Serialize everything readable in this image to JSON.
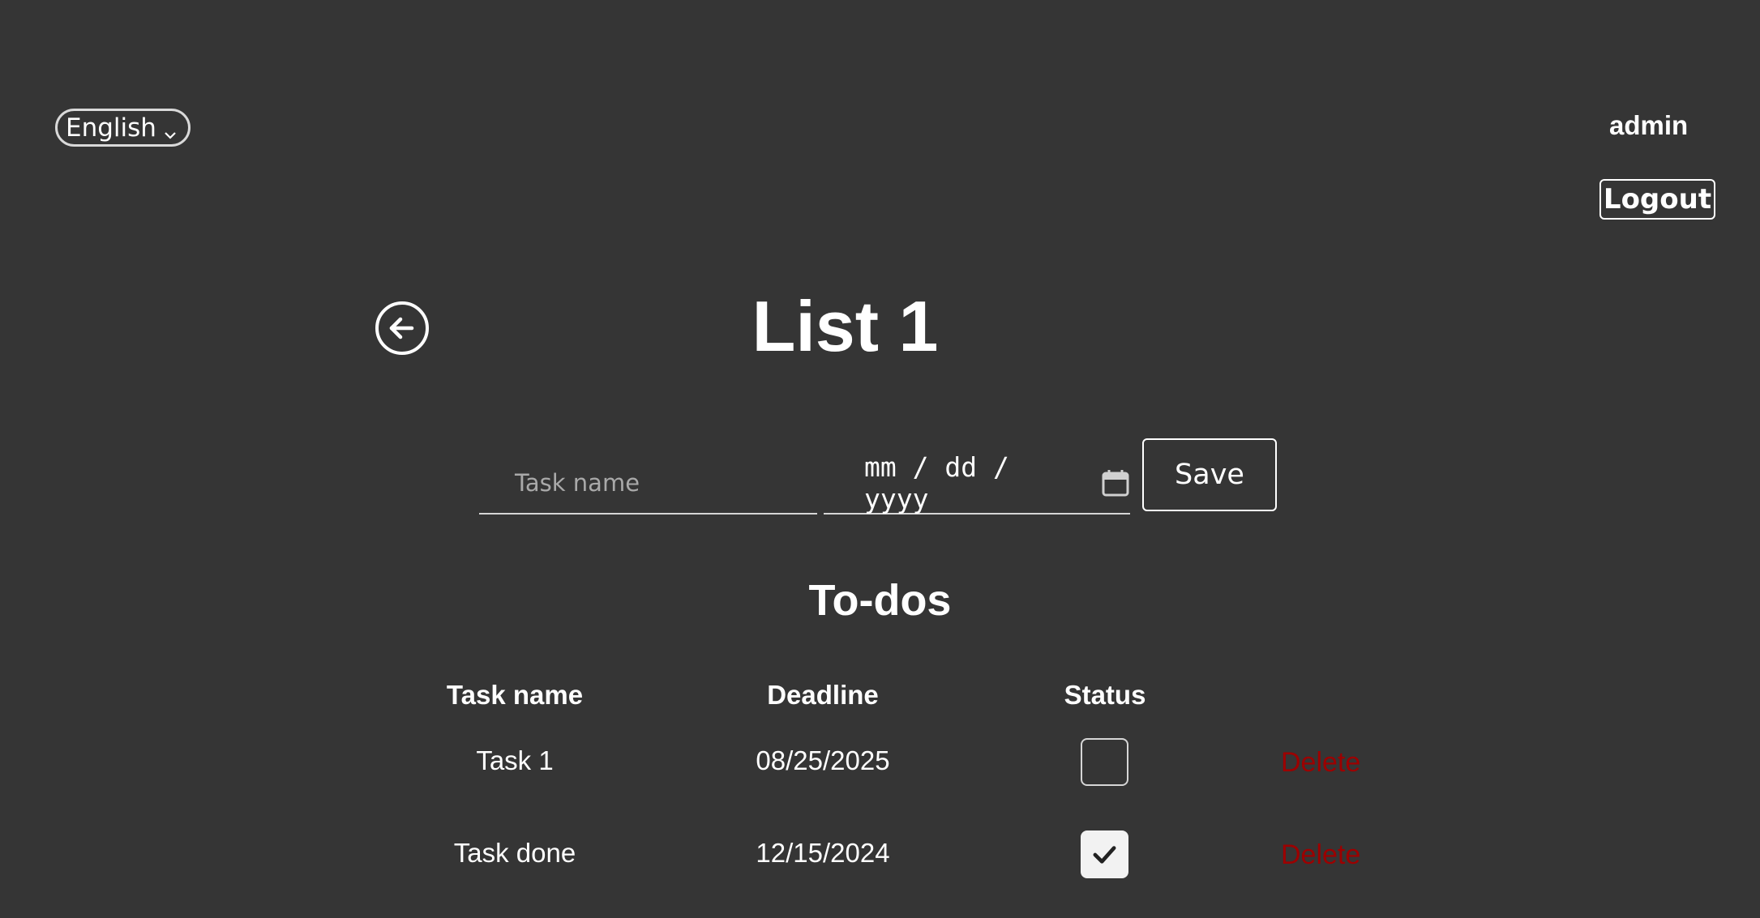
{
  "header": {
    "language": {
      "selected": "English"
    },
    "user": {
      "name": "admin",
      "logout_label": "Logout"
    }
  },
  "main": {
    "title": "List 1",
    "form": {
      "task_placeholder": "Task name",
      "date_placeholder": "mm / dd / yyyy",
      "save_label": "Save"
    },
    "todos": {
      "title": "To-dos",
      "columns": [
        "Task name",
        "Deadline",
        "Status"
      ],
      "rows": [
        {
          "name": "Task 1",
          "deadline": "08/25/2025",
          "done": false,
          "delete_label": "Delete"
        },
        {
          "name": "Task done",
          "deadline": "12/15/2024",
          "done": true,
          "delete_label": "Delete"
        }
      ]
    }
  },
  "colors": {
    "background": "#353535",
    "text": "#ffffff",
    "delete": "#9c0000"
  }
}
